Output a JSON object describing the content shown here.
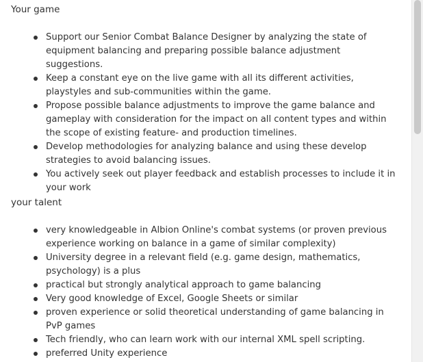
{
  "sections": [
    {
      "title": "Your game",
      "items": [
        "Support our Senior Combat Balance Designer by analyzing the state of equipment balancing and preparing possible balance adjustment suggestions.",
        "Keep a constant eye on the live game with all its different activities, playstyles and sub-communities within the game.",
        "Propose possible balance adjustments to improve the game balance and gameplay with consideration for the impact on all content types and within the scope of existing feature- and production timelines.",
        "Develop methodologies for analyzing balance and using these develop strategies to avoid balancing issues.",
        "You actively seek out player feedback and establish processes to include it in your work"
      ]
    },
    {
      "title": "your talent",
      "items": [
        "very knowledgeable in Albion Online's combat systems (or proven previous experience working on balance in a game of similar complexity)",
        "University degree in a relevant field (e.g. game design, mathematics, psychology) is a plus",
        "practical but strongly analytical approach to game balancing",
        "Very good knowledge of Excel, Google Sheets or similar",
        "proven experience or solid theoretical understanding of game balancing in PvP games",
        "Tech friendly, who can learn work with our internal XML spell scripting.",
        "preferred Unity experience"
      ]
    }
  ],
  "scrollbar": {
    "position_fraction": 0.0,
    "visible_fraction": 0.37
  }
}
